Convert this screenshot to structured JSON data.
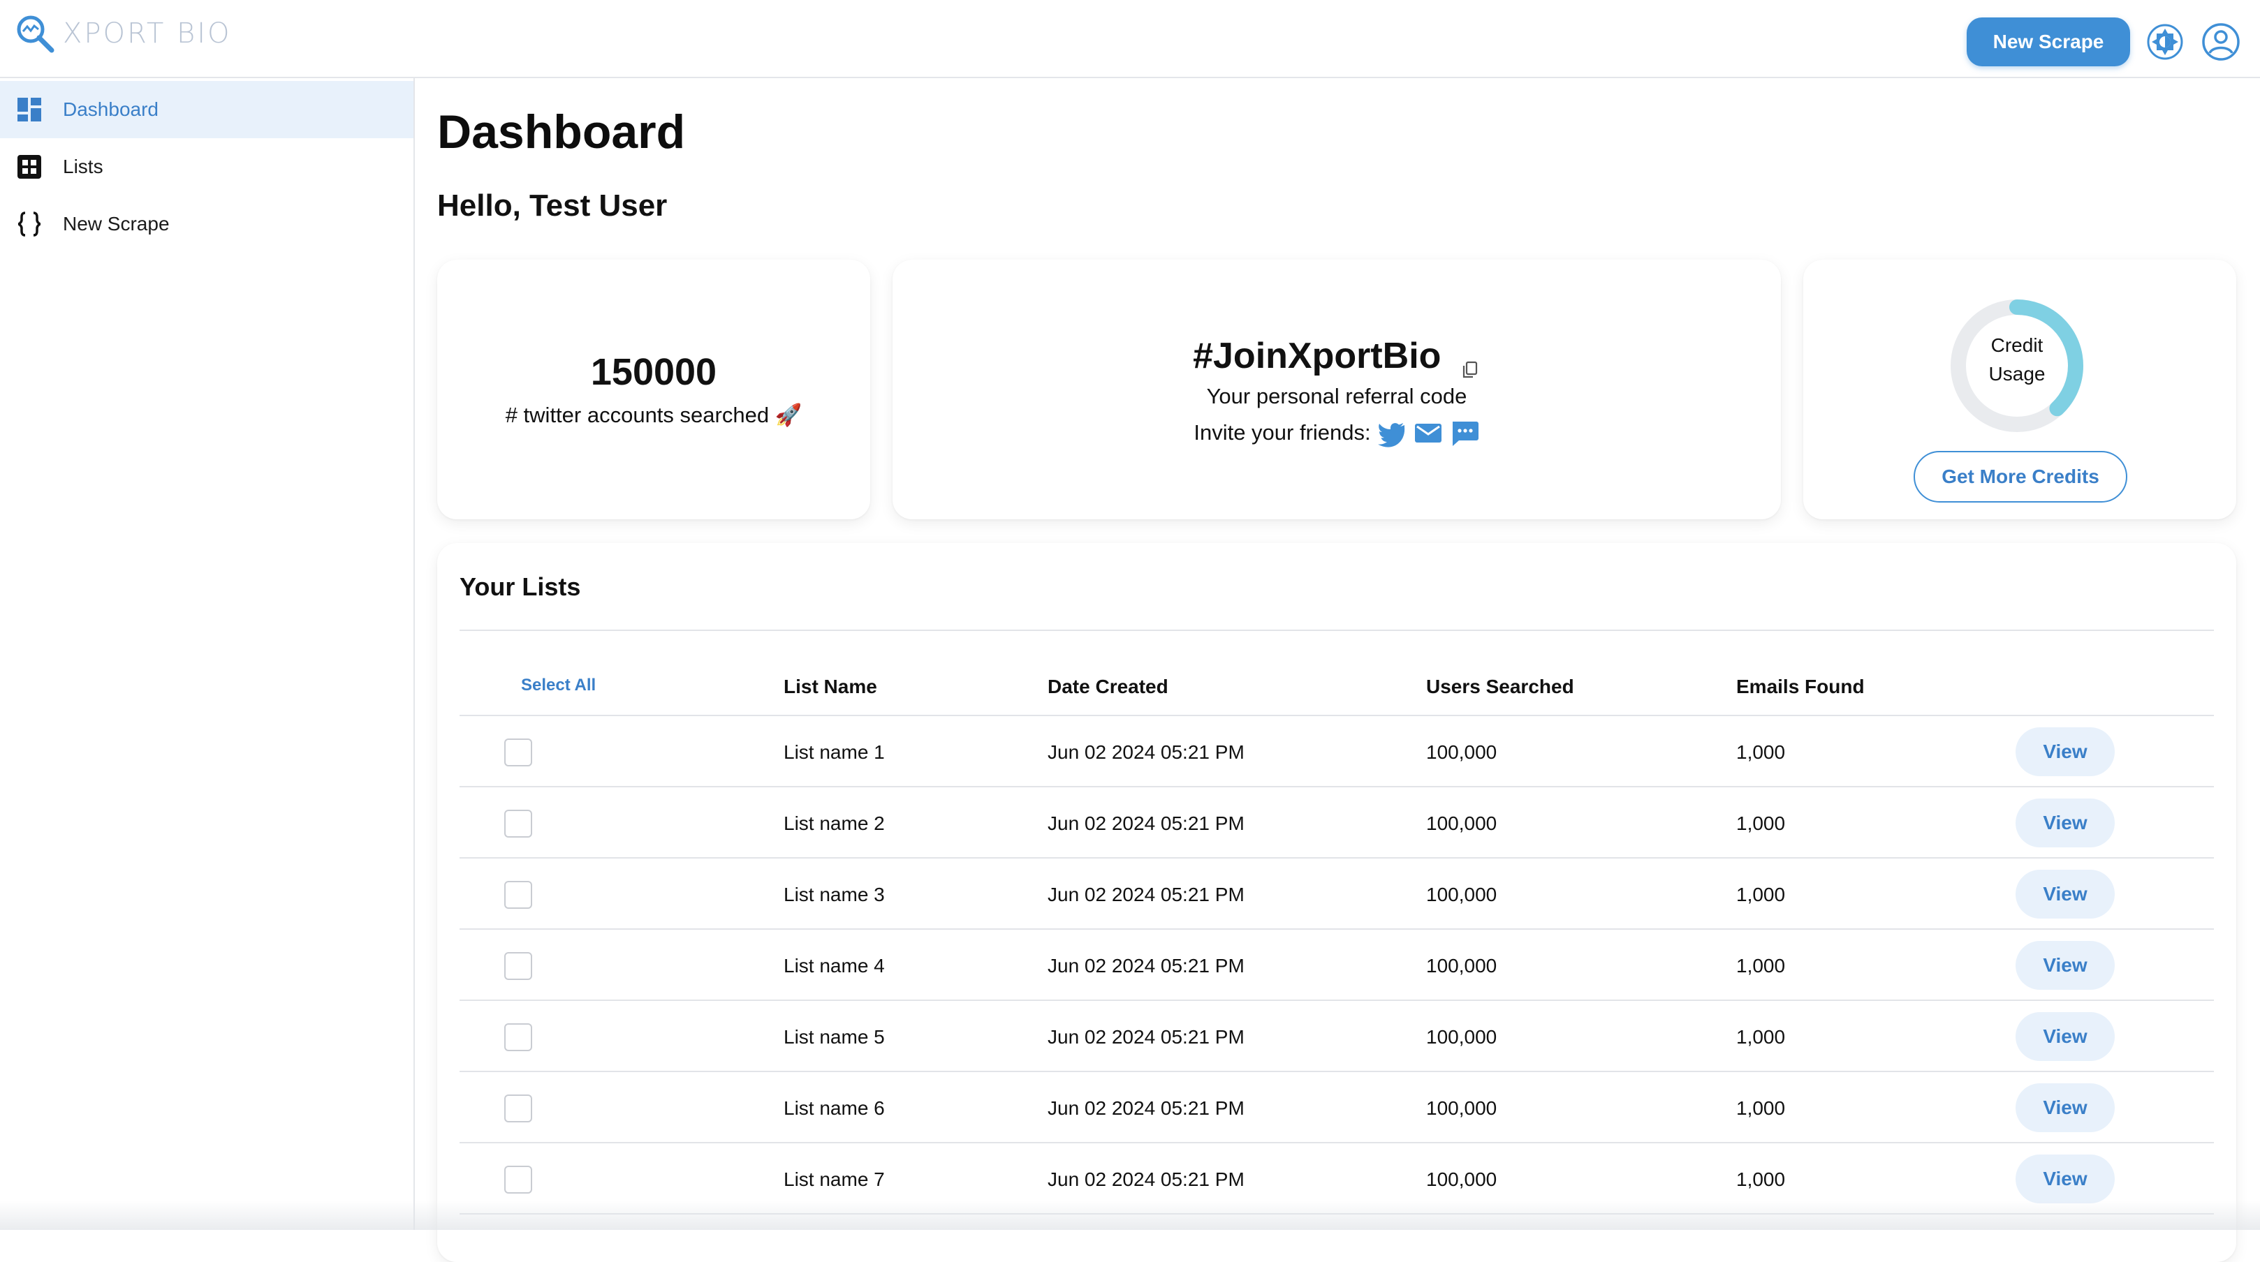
{
  "brand": {
    "name": "XPORT BIO",
    "accent": "#3f8fd6"
  },
  "topbar": {
    "new_scrape_label": "New Scrape",
    "theme_icon": "brightness-icon",
    "account_icon": "account-circle-icon"
  },
  "sidebar": {
    "items": [
      {
        "label": "Dashboard",
        "icon": "dashboard-icon",
        "active": true
      },
      {
        "label": "Lists",
        "icon": "grid-icon",
        "active": false
      },
      {
        "label": "New Scrape",
        "icon": "braces-icon",
        "active": false
      }
    ]
  },
  "main": {
    "title": "Dashboard",
    "greeting": "Hello, Test User"
  },
  "stats": {
    "searched_count": "150000",
    "searched_label": "# twitter accounts searched 🚀"
  },
  "referral": {
    "code": "#JoinXportBio",
    "subtitle": "Your personal referral code",
    "invite_label": "Invite your friends:",
    "share_icons": [
      "twitter-icon",
      "email-icon",
      "message-icon"
    ]
  },
  "credits": {
    "label_line1": "Credit",
    "label_line2": "Usage",
    "used_fraction": 0.38,
    "button_label": "Get More Credits",
    "ring_color": "#7fd0e3",
    "track_color": "#e9ebee"
  },
  "lists": {
    "title": "Your Lists",
    "select_all": "Select All",
    "columns": [
      "List Name",
      "Date Created",
      "Users Searched",
      "Emails Found"
    ],
    "view_label": "View",
    "rows": [
      {
        "name": "List name 1",
        "date": "Jun 02 2024 05:21 PM",
        "users": "100,000",
        "emails": "1,000"
      },
      {
        "name": "List name 2",
        "date": "Jun 02 2024 05:21 PM",
        "users": "100,000",
        "emails": "1,000"
      },
      {
        "name": "List name 3",
        "date": "Jun 02 2024 05:21 PM",
        "users": "100,000",
        "emails": "1,000"
      },
      {
        "name": "List name 4",
        "date": "Jun 02 2024 05:21 PM",
        "users": "100,000",
        "emails": "1,000"
      },
      {
        "name": "List name 5",
        "date": "Jun 02 2024 05:21 PM",
        "users": "100,000",
        "emails": "1,000"
      },
      {
        "name": "List name 6",
        "date": "Jun 02 2024 05:21 PM",
        "users": "100,000",
        "emails": "1,000"
      },
      {
        "name": "List name 7",
        "date": "Jun 02 2024 05:21 PM",
        "users": "100,000",
        "emails": "1,000"
      }
    ]
  }
}
